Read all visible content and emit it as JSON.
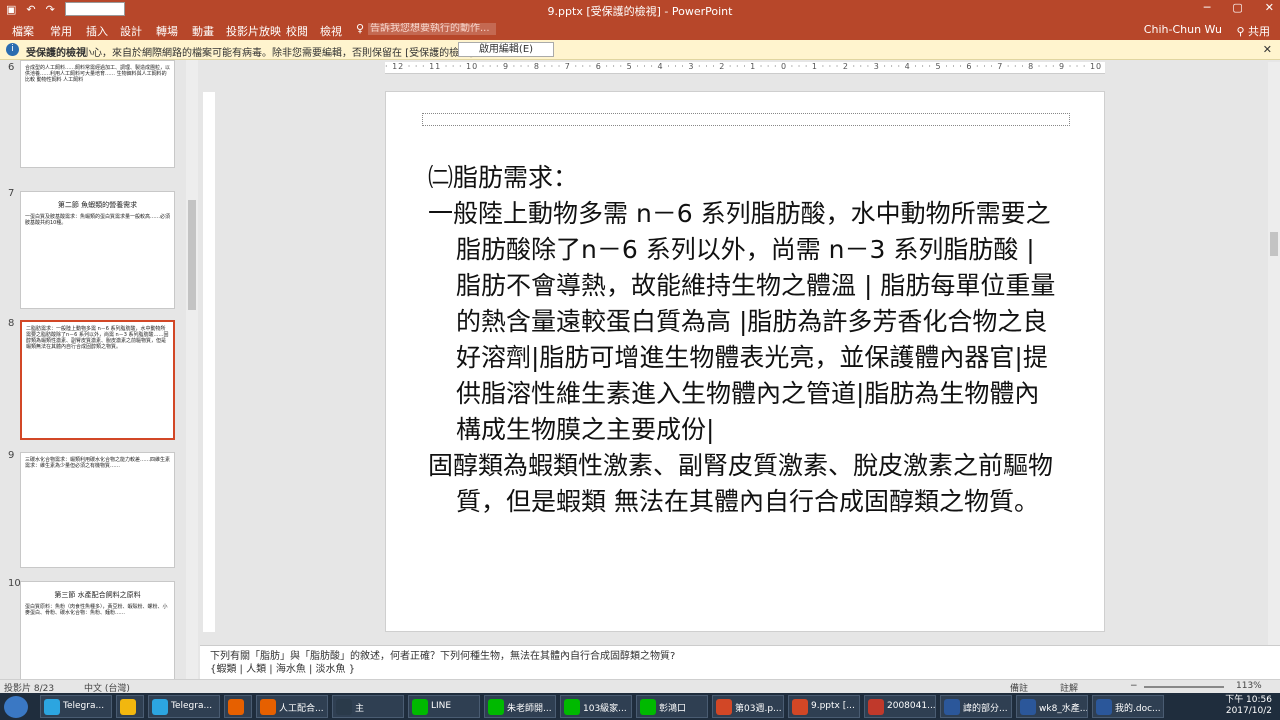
{
  "titlebar": {
    "title": "9.pptx [受保護的檢視] - PowerPoint",
    "quick_icons": [
      "save-icon",
      "undo-icon",
      "redo-icon"
    ],
    "controls": [
      "─",
      "▢",
      "✕"
    ]
  },
  "ribbon": {
    "tabs": [
      "檔案",
      "常用",
      "插入",
      "設計",
      "轉場",
      "動畫",
      "投影片放映",
      "校閱",
      "檢視"
    ],
    "search_placeholder": "告訴我您想要執行的動作...",
    "user": "Chih-Chun Wu",
    "share": "共用"
  },
  "message_bar": {
    "label": "受保護的檢視",
    "text": "小心，來自於網際網路的檔案可能有病毒。除非您需要編輯，否則保留在 [受保護的檢視] 中較為安全。",
    "button": "啟用編輯(E)",
    "close": "✕"
  },
  "thumbnails": [
    {
      "num": "6",
      "title": "",
      "text": "合成型的人工飼料……飼料常需經過加工、調理、製造成團粒，以供池養……利用人工飼料可大量培育…… 生物餌料與人工飼料的比較 動物性飼料 人工飼料"
    },
    {
      "num": "7",
      "title": "第二節 魚蝦類的營養需求",
      "text": "一蛋白質及胺基酸需求：魚蝦類的蛋白質需求量一般較高……必須胺基酸共約10種。"
    },
    {
      "num": "8",
      "title": "",
      "text": "二脂肪需求：一般陸上動物多需 n－6 系列脂肪酸，水中動物所需要之脂肪酸除了n－6 系列以外，尚需 n－3 系列脂肪酸……固醇類為蝦類性激素、副腎皮質激素、脫皮激素之前驅物質，但是蝦類無法在其體內自行合成固醇類之物質。"
    },
    {
      "num": "9",
      "title": "",
      "text": "三碳水化合物需求：蝦類利用碳水化合物之能力較差……四維生素需求：維生素為少量但必須之有機物質……"
    },
    {
      "num": "10",
      "title": "第三節 水產配合飼料之原料",
      "text": "蛋白質原料：魚粉（肉食性魚種多），黃豆粉、蝦殼粉、螺粉、小麥蛋白、骨粉、碳水化合物：魚粉、麵粉……"
    }
  ],
  "ruler": "· 12 · · · 11 · · · 10 · · · 9 · · · 8 · · · 7 · · · 6 · · · 5 · · · 4 · · · 3 · · · 2 · · · 1 · · · 0 · · · 1 · · · 2 · · · 3 · · · 4 · · · 5 · · · 6 · · · 7 · · · 8 · · · 9 · · · 10 · · · 11 · · · 12 ·",
  "slide": {
    "heading": "㈡脂肪需求：",
    "para1": "一般陸上動物多需 n－6 系列脂肪酸，水中動物所需要之脂肪酸除了n－6 系列以外，尚需 n－3 系列脂肪酸 | 脂肪不會導熱，故能維持生物之體溫 | 脂肪每單位重量的熱含量遠較蛋白質為高 |脂肪為許多芳香化合物之良好溶劑|脂肪可增進生物體表光亮，並保護體內器官|提供脂溶性維生素進入生物體內之管道|脂肪為生物體內構成生物膜之主要成份|",
    "para2": "固醇類為蝦類性激素、副腎皮質激素、脫皮激素之前驅物質，但是蝦類 無法在其體內自行合成固醇類之物質。"
  },
  "notes": {
    "line1": "下列有關「脂肪」與「脂肪酸」的敘述，何者正確？下列何種生物，無法在其體內自行合成固醇類之物質?",
    "line2": "{蝦類 | 人類 | 海水魚 | 淡水魚 }"
  },
  "status": {
    "slide_count": "投影片 8/23",
    "lang": "中文 (台灣)",
    "notes": "備註",
    "comments": "註解",
    "zoom": "113%"
  },
  "taskbar": {
    "items": [
      {
        "label": "Telegra...",
        "color": "#2ca5e0"
      },
      {
        "label": "",
        "color": "#f2b70f"
      },
      {
        "label": "Telegra...",
        "color": "#2ca5e0"
      },
      {
        "label": "",
        "color": "#e66000"
      },
      {
        "label": "人工配合...",
        "color": "#e66000"
      },
      {
        "label": "主",
        "color": "#2a3a4a"
      },
      {
        "label": "LINE",
        "color": "#00b900"
      },
      {
        "label": "朱老師開...",
        "color": "#00b900"
      },
      {
        "label": "103級家...",
        "color": "#00b900"
      },
      {
        "label": "彰鴻口",
        "color": "#00b900"
      },
      {
        "label": "第03週.p...",
        "color": "#d24726"
      },
      {
        "label": "9.pptx [...",
        "color": "#d24726"
      },
      {
        "label": "2008041...",
        "color": "#c0392b"
      },
      {
        "label": "諱的部分...",
        "color": "#2b579a"
      },
      {
        "label": "wk8_水產...",
        "color": "#2b579a"
      },
      {
        "label": "我的.doc...",
        "color": "#2b579a"
      }
    ],
    "time": "下午 10:56",
    "date": "2017/10/2"
  }
}
